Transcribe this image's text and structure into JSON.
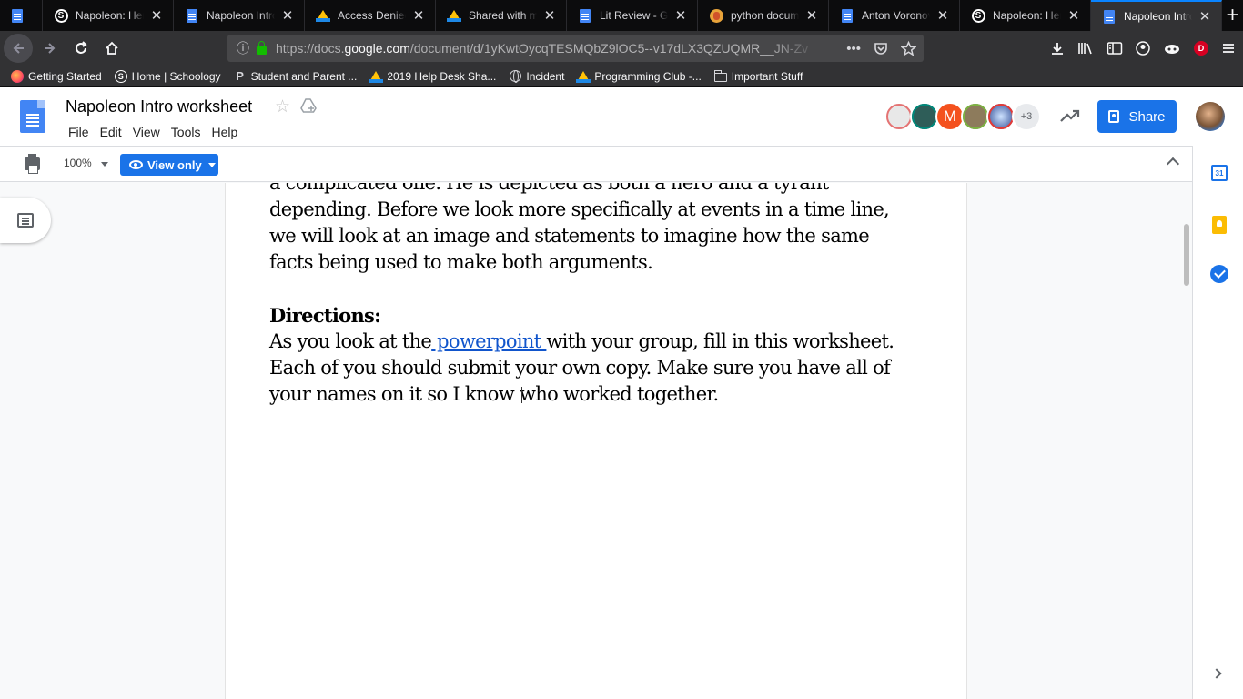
{
  "browser": {
    "tabs": [
      {
        "title": "",
        "icon": "docs-icon",
        "pinned": true
      },
      {
        "title": "Napoleon: Hero",
        "icon": "schoology-icon"
      },
      {
        "title": "Napoleon Intro w",
        "icon": "docs-icon"
      },
      {
        "title": "Access Denied",
        "icon": "drive-icon"
      },
      {
        "title": "Shared with me",
        "icon": "drive-icon"
      },
      {
        "title": "Lit Review - Goo",
        "icon": "docs-icon"
      },
      {
        "title": "python docume",
        "icon": "duckduckgo-icon"
      },
      {
        "title": "Anton Voronov -",
        "icon": "docs-icon"
      },
      {
        "title": "Napoleon: Hero",
        "icon": "schoology-icon"
      },
      {
        "title": "Napoleon Intro w",
        "icon": "docs-icon",
        "active": true
      }
    ],
    "new_tab": "+",
    "url_prefix": "https://docs.",
    "url_host": "google.com",
    "url_path": "/document/d/1yKwtOycqTESMQbZ9lOC5--v17dLX3QZUQMR__JN-Zv",
    "url_actions": [
      "•••"
    ],
    "profile_letter": "D",
    "bookmarks": [
      {
        "label": "Getting Started",
        "icon": "firefox-icon"
      },
      {
        "label": "Home | Schoology",
        "icon": "schoology-icon"
      },
      {
        "label": "Student and Parent ...",
        "icon": "p-icon"
      },
      {
        "label": "2019 Help Desk Sha...",
        "icon": "drive-icon"
      },
      {
        "label": "Incident",
        "icon": "globe-icon"
      },
      {
        "label": "Programming Club -...",
        "icon": "drive-icon"
      },
      {
        "label": "Important Stuff",
        "icon": "folder-icon"
      }
    ]
  },
  "docs": {
    "title": "Napoleon Intro worksheet",
    "menu": [
      "File",
      "Edit",
      "View",
      "Tools",
      "Help"
    ],
    "collaborators": {
      "m_initial": "M",
      "more": "+3"
    },
    "share_label": "Share",
    "zoom": "100%",
    "view_mode": "View only",
    "calendar_day": "31"
  },
  "document": {
    "paragraph1": [
      "a complicated one. He is depicted as both a hero and a tyrant",
      "depending. Before we look more specifically at events in a time line,",
      "we will look at an image and statements to imagine how the same",
      "facts being used to make both arguments."
    ],
    "directions_heading": "Directions:",
    "directions_line1_before": "As you  look at the",
    "directions_link": " powerpoint ",
    "directions_line1_after": " with your group, fill in this worksheet.",
    "directions_line2": "Each of you should submit your own copy. Make sure you have all of",
    "directions_line3": "your names on it so I know who worked together."
  }
}
